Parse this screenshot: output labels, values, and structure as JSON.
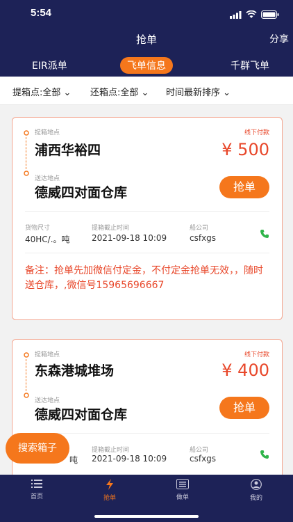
{
  "status_bar": {
    "time": "5:54"
  },
  "header": {
    "title": "抢单",
    "share": "分享"
  },
  "tabs": [
    {
      "label": "EIR派单",
      "active": false
    },
    {
      "label": "飞单信息",
      "active": true
    },
    {
      "label": "千群飞单",
      "active": false
    }
  ],
  "filters": [
    {
      "label": "提箱点:全部"
    },
    {
      "label": "还箱点:全部"
    },
    {
      "label": "时间最新排序"
    }
  ],
  "labels": {
    "pickup": "提箱地点",
    "delivery": "送达地点",
    "offline_pay": "线下付款",
    "grab": "抢单",
    "cargo_size": "货物尺寸",
    "pickup_deadline": "提箱截止时间",
    "ship_company": "船公司"
  },
  "cards": [
    {
      "pickup_place": "浦西华裕四",
      "delivery_place": "德威四对面仓库",
      "price": "¥ 500",
      "cargo_size": "40HC/.。吨",
      "deadline": "2021-09-18 10:09",
      "ship_company": "csfxgs",
      "note": "备注：抢单先加微信付定金，不付定金抢单无效，，随时送仓库，,微信号15965696667"
    },
    {
      "pickup_place": "东森港城堆场",
      "delivery_place": "德威四对面仓库",
      "price": "¥ 400",
      "cargo_size": "吨",
      "deadline": "2021-09-18 10:09",
      "ship_company": "csfxgs"
    }
  ],
  "search_button": "搜索箱子",
  "tabbar": [
    {
      "label": "首页",
      "icon": "list-icon",
      "active": false
    },
    {
      "label": "抢单",
      "icon": "lightning-icon",
      "active": true
    },
    {
      "label": "做单",
      "icon": "document-icon",
      "active": false
    },
    {
      "label": "我的",
      "icon": "user-icon",
      "active": false
    }
  ],
  "colors": {
    "navy": "#1d2257",
    "accent": "#f5771c",
    "price_red": "#e8472a"
  }
}
